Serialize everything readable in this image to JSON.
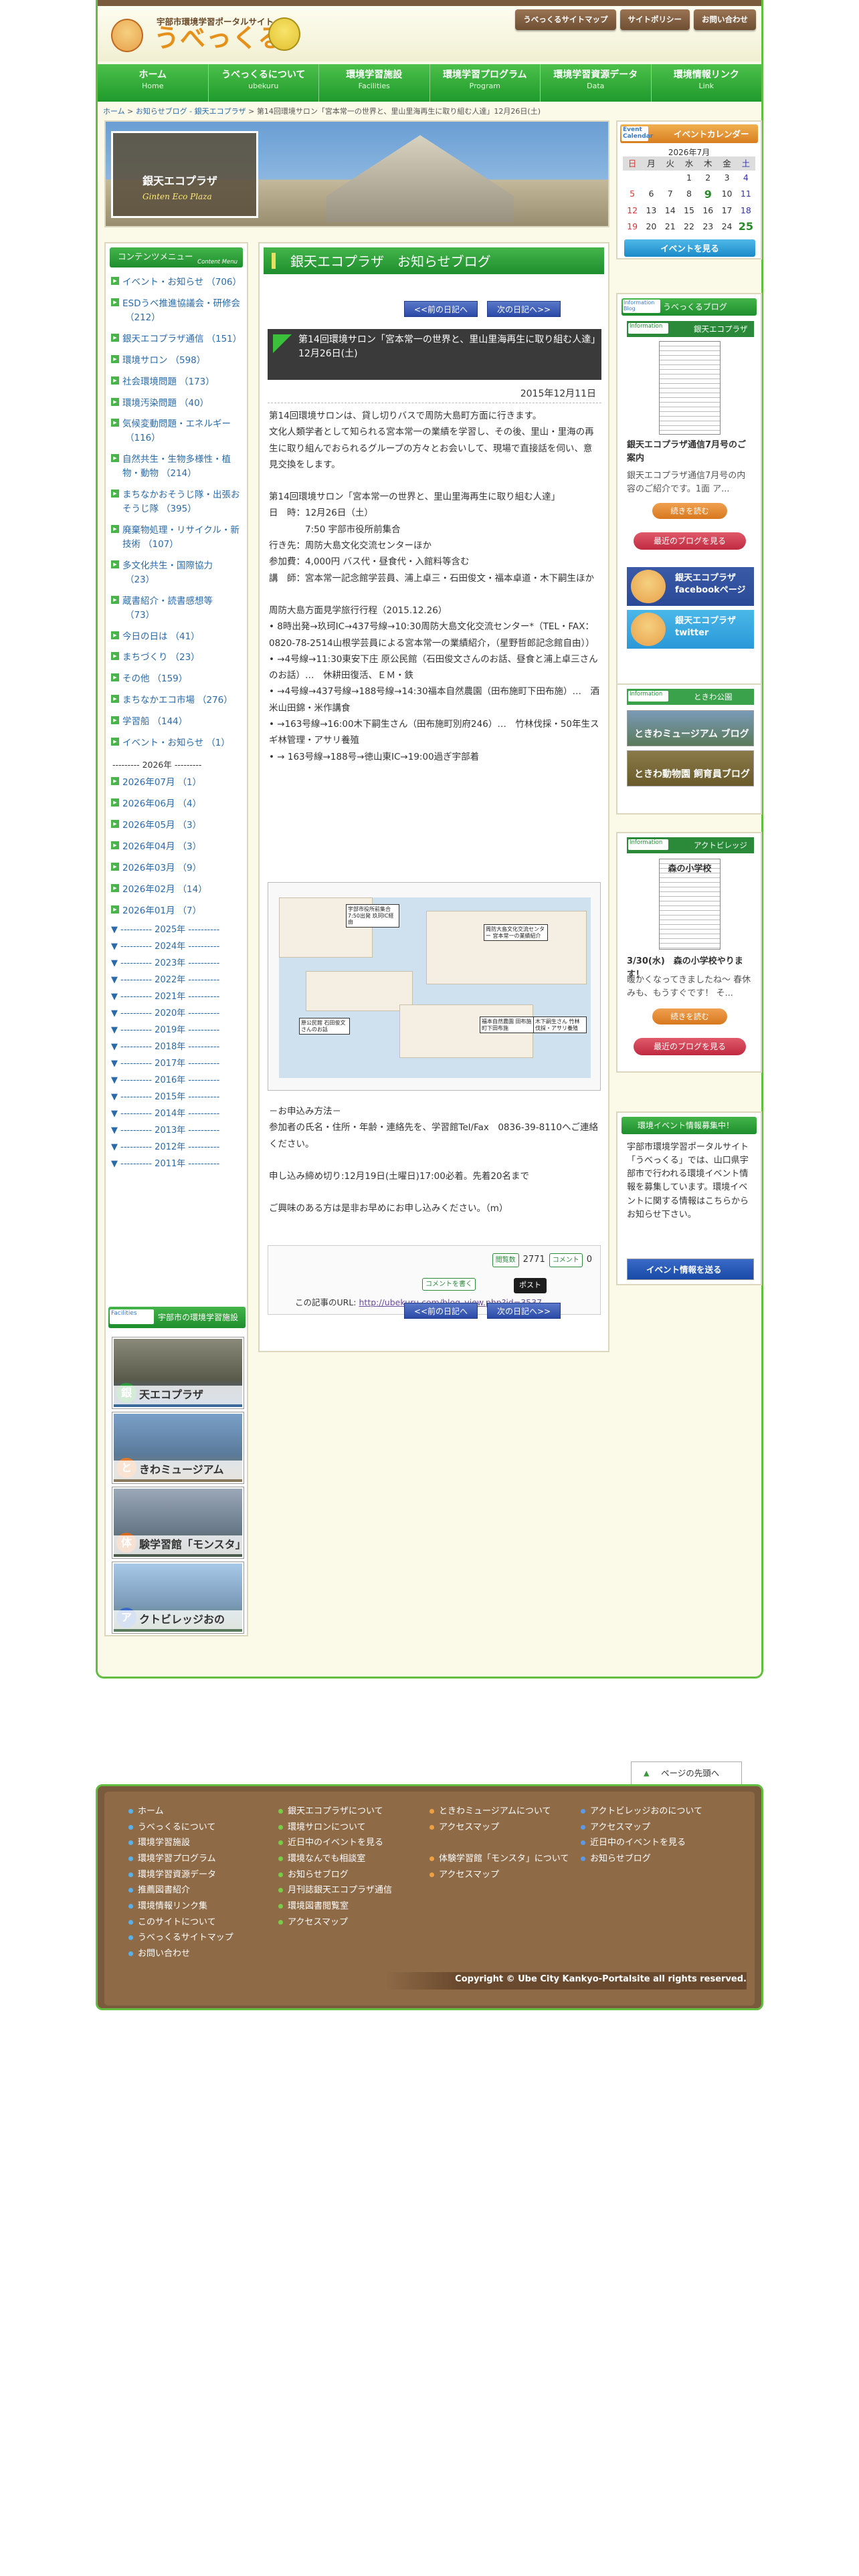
{
  "header": {
    "tagline": "宇部市環境学習ポータルサイト",
    "site_name": "うべっくる",
    "top_links": [
      "うべっくるサイトマップ",
      "サイトポリシー",
      "お問い合わせ"
    ]
  },
  "nav": [
    {
      "label": "ホーム",
      "sub": "Home"
    },
    {
      "label": "うべっくるについて",
      "sub": "ubekuru"
    },
    {
      "label": "環境学習施設",
      "sub": "Facilities"
    },
    {
      "label": "環境学習プログラム",
      "sub": "Program"
    },
    {
      "label": "環境学習資源データ",
      "sub": "Data"
    },
    {
      "label": "環境情報リンク",
      "sub": "Link"
    }
  ],
  "breadcrumb": {
    "home": "ホーム",
    "blog": "お知らせブログ - 銀天エコプラザ",
    "current": "第14回環境サロン「宮本常一の世界と、里山里海再生に取り組む人達」12月26日(土)"
  },
  "hero": {
    "title": "銀天エコプラザ",
    "subtitle": "Ginten Eco Plaza"
  },
  "calendar": {
    "badge": "Event Calendar",
    "title": "イベントカレンダー",
    "month": "2026年7月",
    "weekdays": [
      "日",
      "月",
      "火",
      "水",
      "木",
      "金",
      "土"
    ],
    "weeks": [
      [
        "",
        "",
        "",
        "1",
        "2",
        "3",
        "4"
      ],
      [
        "5",
        "6",
        "7",
        "8",
        "9",
        "10",
        "11"
      ],
      [
        "12",
        "13",
        "14",
        "15",
        "16",
        "17",
        "18"
      ],
      [
        "19",
        "20",
        "21",
        "22",
        "23",
        "24",
        "25"
      ],
      [
        "26",
        "27",
        "28",
        "29",
        "30",
        "31",
        ""
      ]
    ],
    "button": "イベントを見る"
  },
  "sidebar": {
    "title": "コンテンツメニュー",
    "title_en": "Content Menu",
    "categories": [
      {
        "label": "イベント・お知らせ",
        "count": "（706）"
      },
      {
        "label": "ESDうべ推進協議会・研修会",
        "count": "（212）"
      },
      {
        "label": "銀天エコプラザ通信",
        "count": "（151）"
      },
      {
        "label": "環境サロン",
        "count": "（598）"
      },
      {
        "label": "社会環境問題",
        "count": "（173）"
      },
      {
        "label": "環境汚染問題",
        "count": "（40）"
      },
      {
        "label": "気候変動問題・エネルギー",
        "count": "（116）"
      },
      {
        "label": "自然共生・生物多様性・植物・動物",
        "count": "（214）"
      },
      {
        "label": "まちなかおそうじ隊・出張おそうじ隊",
        "count": "（395）"
      },
      {
        "label": "廃棄物処理・リサイクル・新技術",
        "count": "（107）"
      },
      {
        "label": "多文化共生・国際協力",
        "count": "（23）"
      },
      {
        "label": "蔵書紹介・読書感想等",
        "count": "（73）"
      },
      {
        "label": "今日の日は",
        "count": "（41）"
      },
      {
        "label": "まちづくり",
        "count": "（23）"
      },
      {
        "label": "その他",
        "count": "（159）"
      },
      {
        "label": "まちなかエコ市場",
        "count": "（276）"
      },
      {
        "label": "学習船",
        "count": "（144）"
      },
      {
        "label": "イベント・お知らせ",
        "count": "（1）"
      }
    ],
    "year_label": "--------- 2026年 ---------",
    "months": [
      {
        "label": "2026年07月",
        "count": "（1）"
      },
      {
        "label": "2026年06月",
        "count": "（4）"
      },
      {
        "label": "2026年05月",
        "count": "（3）"
      },
      {
        "label": "2026年04月",
        "count": "（3）"
      },
      {
        "label": "2026年03月",
        "count": "（9）"
      },
      {
        "label": "2026年02月",
        "count": "（14）"
      },
      {
        "label": "2026年01月",
        "count": "（7）"
      }
    ],
    "years": [
      "---------- 2025年 ----------",
      "---------- 2024年 ----------",
      "---------- 2023年 ----------",
      "---------- 2022年 ----------",
      "---------- 2021年 ----------",
      "---------- 2020年 ----------",
      "---------- 2019年 ----------",
      "---------- 2018年 ----------",
      "---------- 2017年 ----------",
      "---------- 2016年 ----------",
      "---------- 2015年 ----------",
      "---------- 2014年 ----------",
      "---------- 2013年 ----------",
      "---------- 2012年 ----------",
      "---------- 2011年 ----------"
    ],
    "facilities_badge": "Facilities",
    "facilities_title": "宇部市の環境学習施設",
    "facilities": [
      {
        "char": "銀",
        "label": "天エコプラザ"
      },
      {
        "char": "と",
        "label": "きわミュージアム"
      },
      {
        "char": "体",
        "label": "験学習館「モンスタ」"
      },
      {
        "char": "ア",
        "label": "クトビレッジおの"
      }
    ]
  },
  "main": {
    "section_title": "銀天エコプラザ　お知らせブログ",
    "prev": "<<前の日記へ",
    "next": "次の日記へ>>",
    "entry_title": "第14回環境サロン「宮本常一の世界と、里山里海再生に取り組む人達」12月26日(土)",
    "entry_date": "2015年12月11日",
    "body": [
      "第14回環境サロンは、貸し切りバスで周防大島町方面に行きます。",
      "文化人類学者として知られる宮本常一の業績を学習し、その後、里山・里海の再生に取り組んでおられるグループの方々とお会いして、現場で直接話を伺い、意見交換をします。",
      "",
      "第14回環境サロン「宮本常一の世界と、里山里海再生に取り組む人達」",
      "日　時：12月26日（土）",
      "　　　　7:50 宇部市役所前集合",
      "行き先：周防大島文化交流センターほか",
      "参加費：4,000円 バス代・昼食代・入館料等含む",
      "講　師：宮本常一記念館学芸員、浦上卓三・石田俊文・福本卓道・木下嗣生ほか",
      "",
      "周防大島方面見学旅行行程（2015.12.26）",
      "• 8時出発→玖珂IC→437号線→10:30周防大島文化交流センター*（TEL・FAX：0820-78-2514山根学芸員による宮本常一の業績紹介，（星野哲郎記念館自由））",
      "• →4号線→11:30東安下庄 原公民館（石田俊文さんのお話、昼食と浦上卓三さんのお話）…　休耕田復活、ＥＭ・鉄",
      "• →4号線→437号線→188号線→14:30福本自然農園（田布施町下田布施）…　酒米山田錦・米作講食",
      "• →163号線→16:00木下嗣生さん（田布施町別府246）…　竹林伐採・50年生スギ林管理・アサリ養殖",
      "• → 163号線→188号→徳山東IC→19:00過ぎ宇部着"
    ],
    "map_notes": [
      "宇部市役所前集合 7:50出発 玖珂IC経由",
      "周防大島文化交流センター 宮本常一の業績紹介",
      "原公民館 石田俊文さんのお話",
      "福本自然農園 田布施町下田布施",
      "木下嗣生さん 竹林伐採・アサリ養殖"
    ],
    "after": [
      "－お申込み方法－",
      "参加者の氏名・住所・年齢・連絡先を、学習館Tel/Fax　0836-39-8110へご連絡ください。",
      "",
      "申し込み締め切り:12月19日(土曜日)17:00必着。先着20名まで",
      "",
      "ご興味のある方は是非お早めにお申し込みください。（m）"
    ],
    "view_label": "閲覧数",
    "view_count": "2771",
    "comment_label": "コメント",
    "comment_count": "0",
    "comment_write": "コメントを書く",
    "tweet": "ポスト",
    "url_label": "この記事のURL:",
    "url": "http://ubekuru.com/blog_view.php?id=3537"
  },
  "right": {
    "blog_badge": "Information Blog",
    "blog_title": "うべっくるブログ",
    "info_tag": "Information",
    "ginten_label": "銀天エコプラザ",
    "ginten_post": "銀天エコプラザ通信7月号のご案内",
    "ginten_excerpt": "銀天エコプラザ通信7月号の内容のご紹介です。1面 ア...",
    "continue": "続きを読む",
    "recent": "最近のブログを見る",
    "facebook": "銀天エコプラザ facebookページ",
    "twitter": "銀天エコプラザ twitter",
    "tokiwa_label": "ときわ公園",
    "tokiwa_blog1": "ときわミュージアム ブログ",
    "tokiwa_blog2": "ときわ動物園 飼育員ブログ",
    "act_label": "アクトビレッジおの",
    "act_thumb": "森の小学校",
    "act_post": "3/30(水)　森の小学校やります！",
    "act_excerpt": "暖かくなってきましたね〜 春休みも、もうすぐです！ そ...",
    "event_title": "環境イベント情報募集中！",
    "event_text": "宇部市環境学習ポータルサイト「うべっくる」では、山口県宇部市で行われる環境イベント情報を募集しています。環境イベントに関する情報はこちらからお知らせ下さい。",
    "event_btn": "イベント情報を送る"
  },
  "footer": {
    "totop": "ページの先頭へ",
    "col1": [
      "ホーム",
      "うべっくるについて",
      "環境学習施設",
      "環境学習プログラム",
      "環境学習資源データ",
      "推薦図書紹介",
      "環境情報リンク集",
      "このサイトについて",
      "うべっくるサイトマップ",
      "お問い合わせ"
    ],
    "col2": [
      "銀天エコプラザについて",
      "環境サロンについて",
      "近日中のイベントを見る",
      "環境なんでも相談室",
      "お知らせブログ",
      "月刊誌銀天エコプラザ通信",
      "環境図書閲覧室",
      "アクセスマップ"
    ],
    "col3": [
      "ときわミュージアムについて",
      "アクセスマップ",
      "",
      "体験学習館「モンスタ」について",
      "アクセスマップ"
    ],
    "col4": [
      "アクトビレッジおのについて",
      "アクセスマップ",
      "近日中のイベントを見る",
      "お知らせブログ"
    ],
    "copyright": "Copyright © Ube City Kankyo-Portalsite all rights reserved."
  }
}
